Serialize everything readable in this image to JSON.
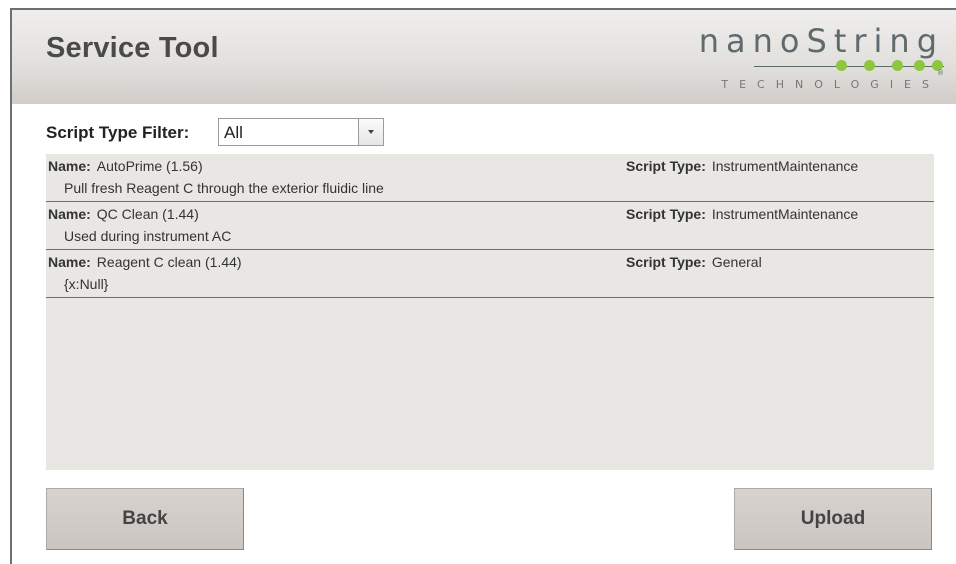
{
  "header": {
    "title": "Service Tool",
    "logo": {
      "word": "nanoString",
      "sub": "TECHNOLOGIES",
      "registered": "®",
      "dot_color": "#8dc63f"
    }
  },
  "filter": {
    "label": "Script Type Filter:",
    "selected": "All"
  },
  "scripts": [
    {
      "name_label": "Name:",
      "name": "AutoPrime (1.56)",
      "type_label": "Script Type:",
      "type": "InstrumentMaintenance",
      "description": "Pull fresh Reagent C through the exterior fluidic line"
    },
    {
      "name_label": "Name:",
      "name": "QC Clean (1.44)",
      "type_label": "Script Type:",
      "type": "InstrumentMaintenance",
      "description": "Used during instrument AC"
    },
    {
      "name_label": "Name:",
      "name": "Reagent C clean (1.44)",
      "type_label": "Script Type:",
      "type": "General",
      "description": "{x:Null}"
    }
  ],
  "buttons": {
    "back": "Back",
    "upload": "Upload"
  },
  "colors": {
    "header_bg": "#e3e1de",
    "list_bg": "#e9e7e4",
    "button_bg": "#d1cbc7",
    "logo_green": "#8dc63f"
  }
}
